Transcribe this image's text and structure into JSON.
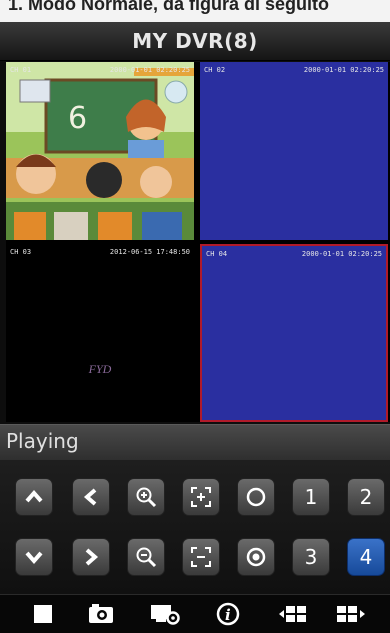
{
  "caption": {
    "text": "1. Modo Normale, da figura di seguito"
  },
  "header": {
    "title": "MY DVR(8)"
  },
  "channels": [
    {
      "id": "CH 01",
      "timestamp": "2000-01-01 02:20:25"
    },
    {
      "id": "CH 02",
      "timestamp": "2000-01-01 02:20:25"
    },
    {
      "id": "CH 03",
      "timestamp": "2012-06-15 17:48:50",
      "overlay": "FYD"
    },
    {
      "id": "CH 04",
      "timestamp": "2000-01-01 02:20:25"
    }
  ],
  "status": {
    "text": "Playing"
  },
  "controls": {
    "channel_buttons": [
      "1",
      "2",
      "3",
      "4"
    ],
    "active_channel": "4"
  },
  "icons": {
    "row1": [
      "up-arrow-icon",
      "left-arrow-icon",
      "zoom-in-icon",
      "focus-in-icon",
      "iris-open-icon"
    ],
    "row2": [
      "down-arrow-icon",
      "right-arrow-icon",
      "zoom-out-icon",
      "focus-out-icon",
      "iris-close-icon"
    ],
    "toolbar": [
      "stop-icon",
      "snapshot-icon",
      "device-settings-icon",
      "info-icon",
      "previous-group-icon",
      "next-group-icon"
    ]
  },
  "colors": {
    "active": "#2a62b8",
    "selected_border": "#b01a2a",
    "no_video": "#2a2fa0"
  }
}
